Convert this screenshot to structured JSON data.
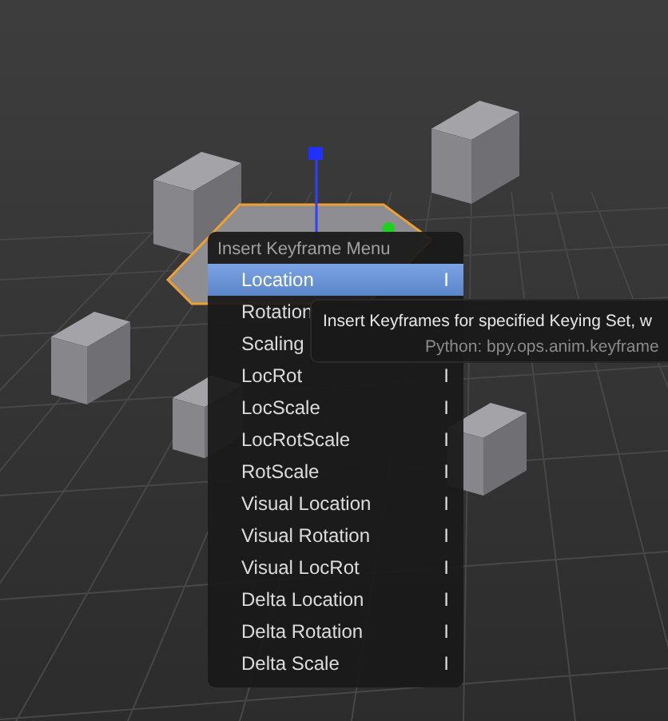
{
  "menu": {
    "title": "Insert Keyframe Menu",
    "items": [
      {
        "label": "Location",
        "shortcut": "I",
        "selected": true
      },
      {
        "label": "Rotation",
        "selected": false
      },
      {
        "label": "Scaling",
        "selected": false
      },
      {
        "label": "LocRot",
        "shortcut": "I",
        "selected": false
      },
      {
        "label": "LocScale",
        "shortcut": "I",
        "selected": false
      },
      {
        "label": "LocRotScale",
        "shortcut": "I",
        "selected": false
      },
      {
        "label": "RotScale",
        "shortcut": "I",
        "selected": false
      },
      {
        "label": "Visual Location",
        "shortcut": "I",
        "selected": false
      },
      {
        "label": "Visual Rotation",
        "shortcut": "I",
        "selected": false
      },
      {
        "label": "Visual LocRot",
        "shortcut": "I",
        "selected": false
      },
      {
        "label": "Delta Location",
        "shortcut": "I",
        "selected": false
      },
      {
        "label": "Delta Rotation",
        "shortcut": "I",
        "selected": false
      },
      {
        "label": "Delta Scale",
        "shortcut": "I",
        "selected": false
      }
    ]
  },
  "tooltip": {
    "description": "Insert Keyframes for specified Keying Set, w",
    "python": "Python: bpy.ops.anim.keyframe"
  }
}
